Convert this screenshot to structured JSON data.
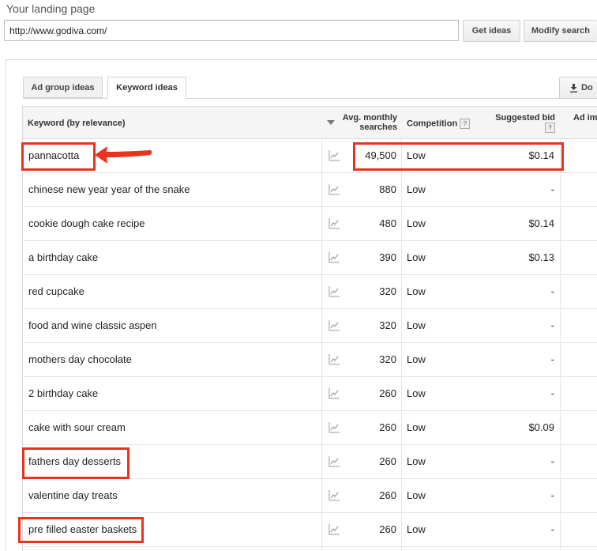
{
  "landing": {
    "label": "Your landing page",
    "url": "http://www.godiva.com/"
  },
  "buttons": {
    "get_ideas": "Get ideas",
    "modify_search": "Modify search",
    "download": "Do"
  },
  "tabs": [
    {
      "label": "Ad group ideas",
      "active": false
    },
    {
      "label": "Keyword ideas",
      "active": true
    }
  ],
  "table": {
    "headers": {
      "keyword": "Keyword (by relevance)",
      "avg_monthly_line1": "Avg. monthly",
      "avg_monthly_line2": "searches",
      "competition": "Competition",
      "suggested_bid": "Suggested bid",
      "ad_impr": "Ad im",
      "help_glyph": "?"
    },
    "rows": [
      {
        "keyword": "pannacotta",
        "searches": "49,500",
        "competition": "Low",
        "bid": "$0.14"
      },
      {
        "keyword": "chinese new year year of the snake",
        "searches": "880",
        "competition": "Low",
        "bid": "-"
      },
      {
        "keyword": "cookie dough cake recipe",
        "searches": "480",
        "competition": "Low",
        "bid": "$0.14"
      },
      {
        "keyword": "a birthday cake",
        "searches": "390",
        "competition": "Low",
        "bid": "$0.13"
      },
      {
        "keyword": "red cupcake",
        "searches": "320",
        "competition": "Low",
        "bid": "-"
      },
      {
        "keyword": "food and wine classic aspen",
        "searches": "320",
        "competition": "Low",
        "bid": "-"
      },
      {
        "keyword": "mothers day chocolate",
        "searches": "320",
        "competition": "Low",
        "bid": "-"
      },
      {
        "keyword": "2 birthday cake",
        "searches": "260",
        "competition": "Low",
        "bid": "-"
      },
      {
        "keyword": "cake with sour cream",
        "searches": "260",
        "competition": "Low",
        "bid": "$0.09"
      },
      {
        "keyword": "fathers day desserts",
        "searches": "260",
        "competition": "Low",
        "bid": "-"
      },
      {
        "keyword": "valentine day treats",
        "searches": "260",
        "competition": "Low",
        "bid": "-"
      },
      {
        "keyword": "pre filled easter baskets",
        "searches": "260",
        "competition": "Low",
        "bid": "-"
      }
    ]
  },
  "annotations": {
    "highlight_color": "#e8331f"
  },
  "icons": {
    "trend": "trend-chart-icon",
    "sort": "sort-desc-icon",
    "download": "download-icon",
    "help": "help-icon"
  }
}
